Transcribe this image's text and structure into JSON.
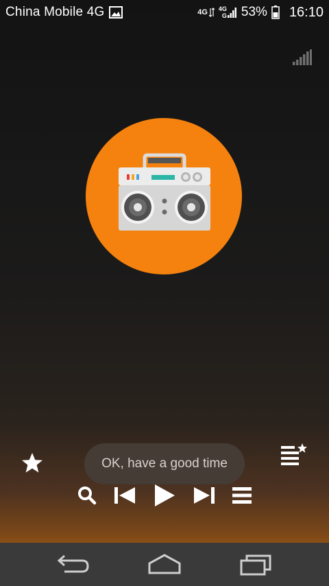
{
  "status_bar": {
    "carrier": "China Mobile 4G",
    "network_labels": [
      "4G",
      "4G",
      "G"
    ],
    "battery_percent": "53%",
    "time": "16:10"
  },
  "icons": {
    "notification": "image-icon",
    "signal": "signal-bars-icon",
    "artwork": "boombox-icon",
    "favorite": "star-icon",
    "add_to_favorites": "list-star-icon",
    "search": "search-icon",
    "previous": "skip-previous-icon",
    "play": "play-icon",
    "next": "skip-next-icon",
    "menu": "menu-icon",
    "back": "back-icon",
    "home": "home-icon",
    "recents": "recents-icon"
  },
  "toast": {
    "message": "OK, have a good time"
  },
  "colors": {
    "accent": "#f5820f",
    "toast_bg": "#463e38",
    "navbar_bg": "#3a3a3a"
  }
}
